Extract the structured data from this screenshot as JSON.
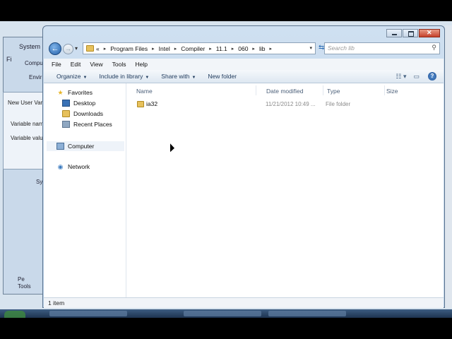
{
  "explorer": {
    "address": {
      "history_glyph": "«",
      "segments": [
        "Program Files",
        "Intel",
        "Compiler",
        "11.1",
        "060",
        "lib"
      ]
    },
    "search": {
      "placeholder": "Search lib"
    },
    "menu": [
      "File",
      "Edit",
      "View",
      "Tools",
      "Help"
    ],
    "commands": {
      "organize": "Organize",
      "include": "Include in library",
      "share": "Share with",
      "new_folder": "New folder"
    },
    "nav": {
      "favorites": "Favorites",
      "desktop": "Desktop",
      "downloads": "Downloads",
      "recent": "Recent Places",
      "computer": "Computer",
      "network": "Network"
    },
    "columns": {
      "name": "Name",
      "date": "Date modified",
      "type": "Type",
      "size": "Size"
    },
    "files": [
      {
        "name": "ia32",
        "date": "11/21/2012 10:49 ...",
        "type": "File folder"
      }
    ],
    "status": "1 item"
  },
  "background": {
    "system_title": "System P",
    "tab": "Comput",
    "env": "Envir",
    "file_label": "Fi",
    "dialog_title": "New User Var",
    "variable_name": "Variable nam",
    "variable_value": "Variable valu",
    "sys_label": "Sys",
    "pe": "Pe",
    "tools": "Tools"
  }
}
